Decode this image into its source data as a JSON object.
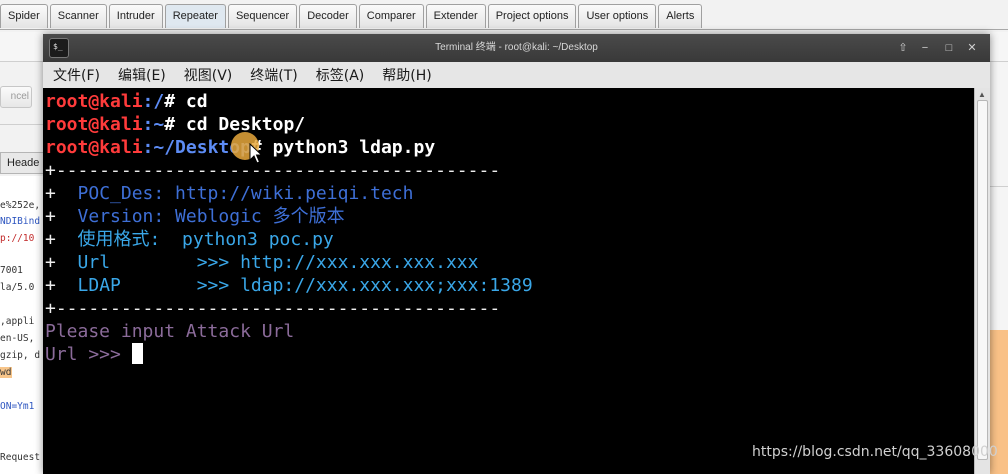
{
  "burp": {
    "tabs": [
      {
        "label": "Spider"
      },
      {
        "label": "Scanner"
      },
      {
        "label": "Intruder"
      },
      {
        "label": "Repeater"
      },
      {
        "label": "Sequencer"
      },
      {
        "label": "Decoder"
      },
      {
        "label": "Comparer"
      },
      {
        "label": "Extender"
      },
      {
        "label": "Project options"
      },
      {
        "label": "User options"
      },
      {
        "label": "Alerts"
      }
    ],
    "active_tab": "Repeater",
    "cancel_label": "ncel",
    "headers_tab_label": "Heade",
    "request_lines": [
      "e%252e,",
      "NDIBind",
      "p://10",
      "7001",
      "la/5.0",
      ",appli",
      "en-US,",
      "gzip, d",
      "wd",
      "ON=Ym1",
      "Request"
    ]
  },
  "terminal": {
    "title": "Terminal 终端 - root@kali: ~/Desktop",
    "icon_glyph": "$_",
    "window_buttons": {
      "up": "⇧",
      "minimize": "−",
      "maximize": "□",
      "close": "✕"
    },
    "menu": [
      {
        "label": "文件(F)"
      },
      {
        "label": "编辑(E)"
      },
      {
        "label": "视图(V)"
      },
      {
        "label": "终端(T)"
      },
      {
        "label": "标签(A)"
      },
      {
        "label": "帮助(H)"
      }
    ],
    "lines": {
      "l1": {
        "user": "root@kali",
        "path": ":/",
        "cmd": "# cd"
      },
      "l2": {
        "user": "root@kali",
        "path": ":~",
        "cmd": "# cd Desktop/"
      },
      "l3": {
        "user": "root@kali",
        "path": ":~/Desktop",
        "cmd": "# python3 ldap.py"
      },
      "border_top": "+-----------------------------------------",
      "poc_des": {
        "plus": "+  ",
        "text": "POC_Des: http://wiki.peiqi.tech"
      },
      "version": {
        "plus": "+  ",
        "text": "Version: Weblogic 多个版本"
      },
      "usage": {
        "plus": "+  ",
        "text": "使用格式:  python3 poc.py"
      },
      "url": {
        "plus": "+  ",
        "text": "Url        >>> http://xxx.xxx.xxx.xxx"
      },
      "ldap": {
        "plus": "+  ",
        "text": "LDAP       >>> ldap://xxx.xxx.xxx;xxx:1389"
      },
      "border_bottom": "+-----------------------------------------",
      "prompt_text": "Please input Attack Url",
      "input_prompt": "Url >>> "
    }
  },
  "watermark": "https://blog.csdn.net/qq_33608000",
  "colors": {
    "user": "#ff3b3b",
    "path": "#5d8cf5",
    "info": "#3e6fd6",
    "info_cyan": "#3aa7e8",
    "prompt": "#8b6b9a",
    "terminal_bg": "#000000"
  }
}
